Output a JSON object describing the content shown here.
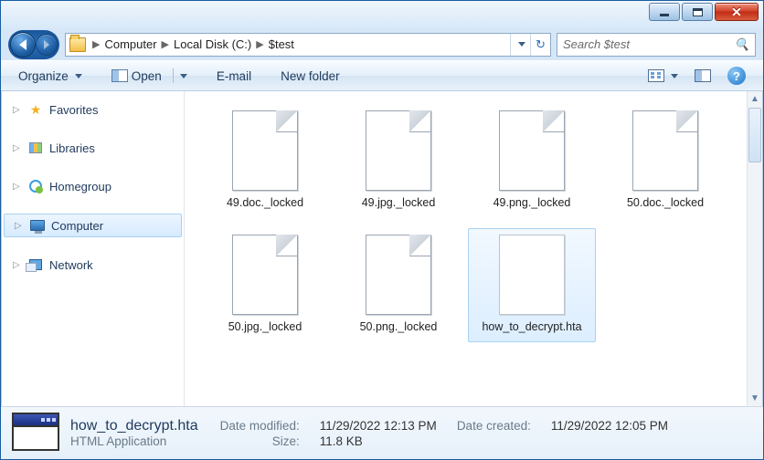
{
  "breadcrumb": {
    "root_icon": "folder",
    "parts": [
      "Computer",
      "Local Disk (C:)",
      "$test"
    ]
  },
  "search": {
    "placeholder": "Search $test"
  },
  "toolbar": {
    "organize": "Organize",
    "open": "Open",
    "email": "E-mail",
    "newfolder": "New folder"
  },
  "sidebar": {
    "items": [
      {
        "label": "Favorites",
        "icon": "star"
      },
      {
        "label": "Libraries",
        "icon": "libs"
      },
      {
        "label": "Homegroup",
        "icon": "hg"
      },
      {
        "label": "Computer",
        "icon": "comp",
        "selected": true
      },
      {
        "label": "Network",
        "icon": "net"
      }
    ]
  },
  "files": [
    {
      "name": "49.doc._locked",
      "type": "doc"
    },
    {
      "name": "49.jpg._locked",
      "type": "doc"
    },
    {
      "name": "49.png._locked",
      "type": "doc"
    },
    {
      "name": "50.doc._locked",
      "type": "doc"
    },
    {
      "name": "50.jpg._locked",
      "type": "doc"
    },
    {
      "name": "50.png._locked",
      "type": "doc"
    },
    {
      "name": "how_to_decrypt.hta",
      "type": "hta",
      "selected": true
    }
  ],
  "details": {
    "filename": "how_to_decrypt.hta",
    "filetype": "HTML Application",
    "modified_label": "Date modified:",
    "modified_value": "11/29/2022 12:13 PM",
    "size_label": "Size:",
    "size_value": "11.8 KB",
    "created_label": "Date created:",
    "created_value": "11/29/2022 12:05 PM"
  }
}
